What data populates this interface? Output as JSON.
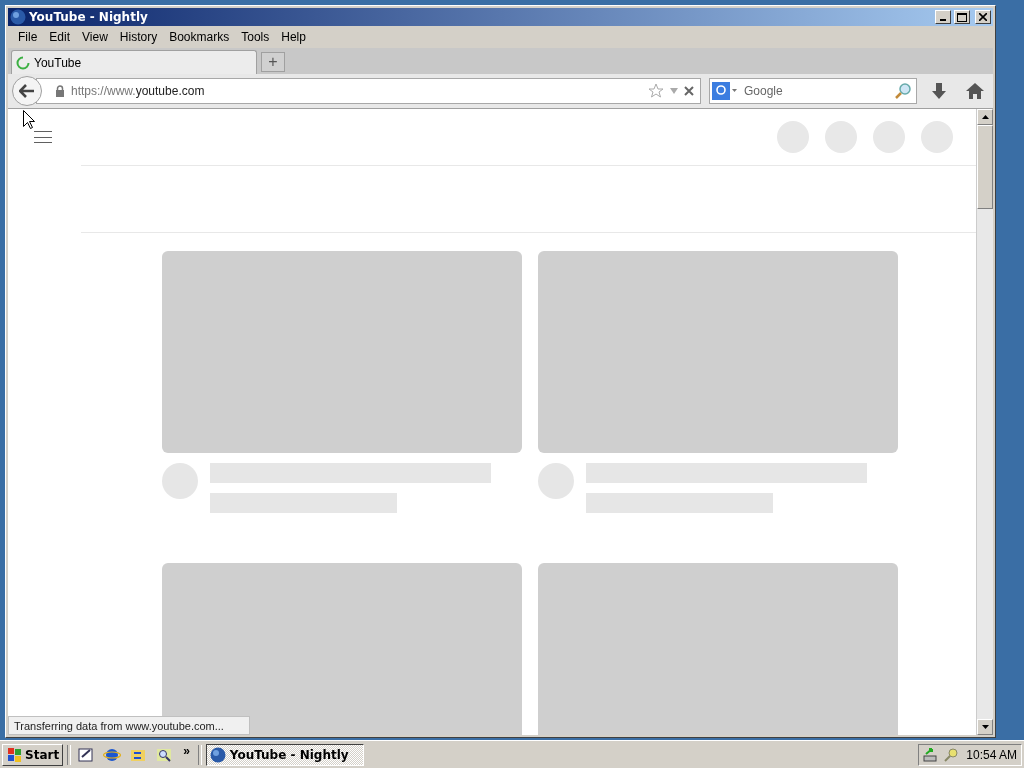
{
  "window": {
    "title": "YouTube - Nightly"
  },
  "menu": [
    "File",
    "Edit",
    "View",
    "History",
    "Bookmarks",
    "Tools",
    "Help"
  ],
  "tabs": [
    {
      "label": "YouTube",
      "selected": true,
      "loading": true
    }
  ],
  "new_tab": "+",
  "address": {
    "prefix": "https://www.",
    "host": "youtube.com",
    "secure": true,
    "bookmarked": false
  },
  "search": {
    "placeholder": "Google"
  },
  "page": {
    "header_placeholders": [
      {
        "kind": "circle"
      },
      {
        "kind": "circle"
      },
      {
        "kind": "circle"
      },
      {
        "kind": "circle"
      }
    ],
    "cards": [
      {
        "kind": "skeleton"
      },
      {
        "kind": "skeleton"
      },
      {
        "kind": "thumbnail"
      },
      {
        "kind": "thumbnail"
      }
    ]
  },
  "status_bar": "Transferring data from www.youtube.com...",
  "taskbar": {
    "start": "Start",
    "more": "»",
    "tasks": [
      {
        "label": "YouTube - Nightly",
        "selected": true
      }
    ],
    "clock": "10:54 AM"
  }
}
